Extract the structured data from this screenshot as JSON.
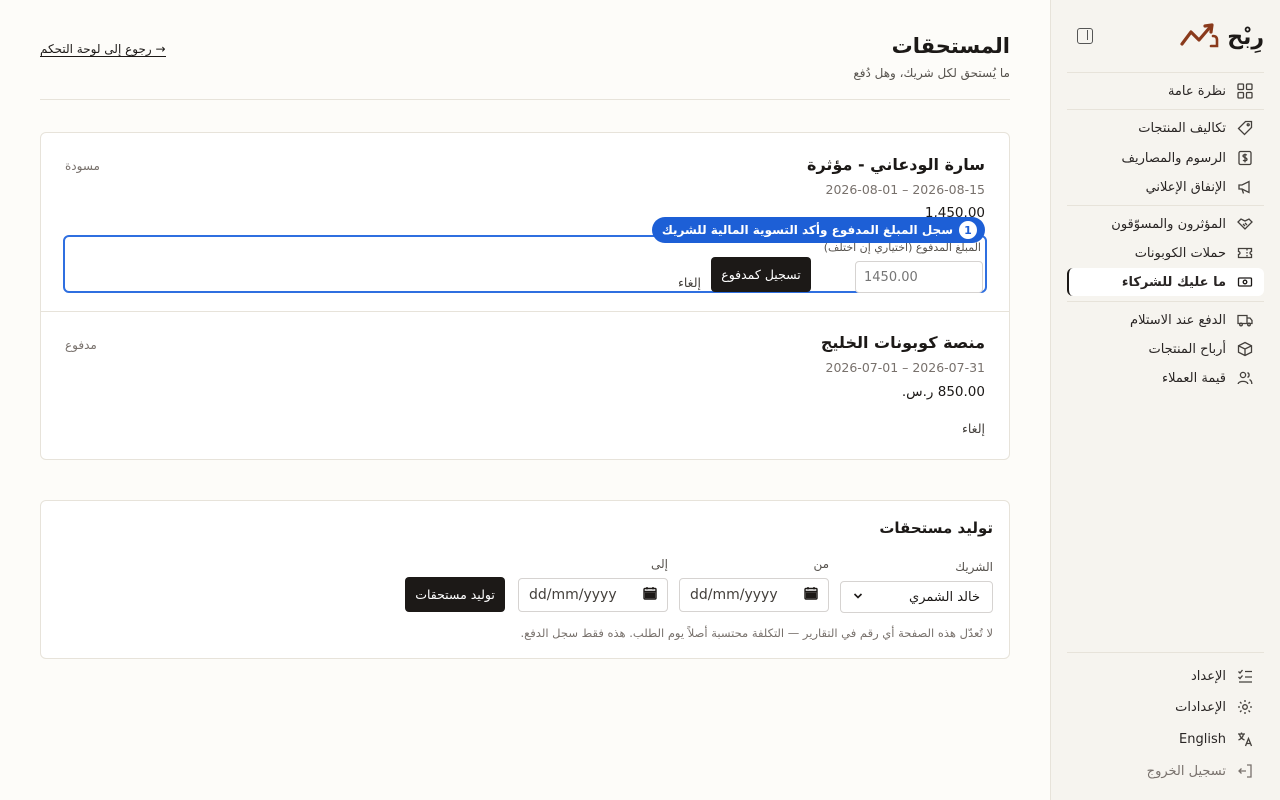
{
  "sidebar": {
    "brand": "رِبْح",
    "collapse_label": "",
    "nav_groups": [
      [
        {
          "label": "نظرة عامة",
          "icon": "grid-icon"
        }
      ],
      [
        {
          "label": "تكاليف المنتجات",
          "icon": "tag-icon"
        },
        {
          "label": "الرسوم والمصاريف",
          "icon": "receipt-icon"
        },
        {
          "label": "الإنفاق الإعلاني",
          "icon": "megaphone-icon"
        }
      ],
      [
        {
          "label": "المؤثرون والمسوّقون",
          "icon": "handshake-icon"
        },
        {
          "label": "حملات الكوبونات",
          "icon": "ticket-icon"
        },
        {
          "label": "ما عليك للشركاء",
          "icon": "cash-icon",
          "active": true
        }
      ],
      [
        {
          "label": "الدفع عند الاستلام",
          "icon": "truck-icon"
        },
        {
          "label": "أرباح المنتجات",
          "icon": "box-icon"
        },
        {
          "label": "قيمة العملاء",
          "icon": "users-icon"
        }
      ]
    ],
    "footer": {
      "setup": "الإعداد",
      "settings": "الإعدادات",
      "language": "English",
      "logout": "تسجيل الخروج"
    }
  },
  "header": {
    "title": "المستحقات",
    "subtitle": "ما يُستحق لكل شريك، وهل دُفع",
    "back_link": "→ رجوع إلى لوحة التحكم"
  },
  "payouts": [
    {
      "partner": "سارة الودعاني - مؤثرة",
      "period": "2026-08-01 – 2026-08-15",
      "amount": "1,450.00",
      "status": "مسودة",
      "form": {
        "label": "المبلغ المدفوع (اختياري إن اختلف)",
        "placeholder": "1450.00",
        "submit": "تسجيل كمدفوع",
        "cancel": "إلغاء"
      }
    },
    {
      "partner": "منصة كوبونات الخليج",
      "period": "2026-07-01 – 2026-07-31",
      "amount": "850.00 ر.س.",
      "status": "مدفوع",
      "cancel": "إلغاء"
    }
  ],
  "tooltip": {
    "step": "1",
    "text": "سجل المبلغ المدفوع وأكد التسوية المالية للشريك"
  },
  "generate": {
    "title": "توليد مستحقات",
    "partner_label": "الشريك",
    "partner_value": "خالد الشمري",
    "from_label": "من",
    "to_label": "إلى",
    "date_placeholder": "dd/mm/yyyy",
    "submit": "توليد مستحقات",
    "hint": "لا تُعدّل هذه الصفحة أي رقم في التقارير — التكلفة محتسبة أصلاً يوم الطلب. هذه فقط سجل الدفع."
  },
  "colors": {
    "accent": "#1d5fd6",
    "brand": "#8a3a1c",
    "dark_button": "#1c1917",
    "background": "#fdfcf9"
  }
}
